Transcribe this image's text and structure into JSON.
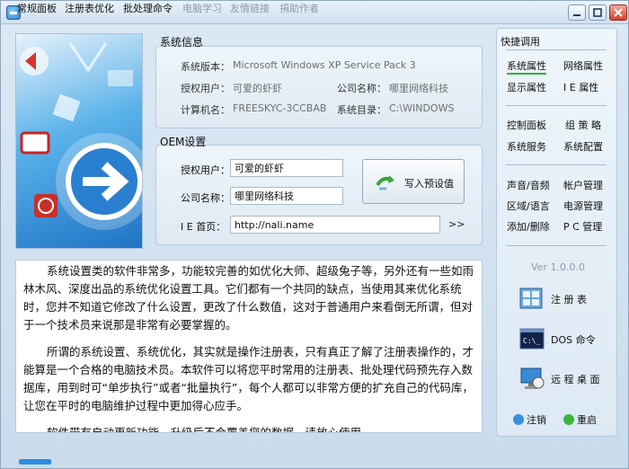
{
  "window": {
    "title": ""
  },
  "system_info": {
    "group_title": "系统信息",
    "rows": [
      {
        "label": "系统版本：",
        "value": "Microsoft Windows XP   Service Pack 3"
      },
      {
        "label": "授权用户：",
        "value": "可爱的虾虾"
      },
      {
        "label": "公司名称：",
        "value": "哪里网络科技"
      },
      {
        "label": "计算机名：",
        "value": "FREESKYC-3CCBAB"
      },
      {
        "label": "系统目录：",
        "value": "C:\\WINDOWS"
      }
    ]
  },
  "oem": {
    "group_title": "OEM设置",
    "user_label": "授权用户：",
    "user_value": "可爱的虾虾",
    "company_label": "公司名称：",
    "company_value": "哪里网络科技",
    "homepage_label": "I E 首页：",
    "homepage_value": "http://nali.name",
    "write_button": "写入预设值",
    "more": ">>"
  },
  "description": {
    "paragraphs": [
      "系统设置类的软件非常多，功能较完善的如优化大师、超级兔子等，另外还有一些如雨林木风、深度出品的系统优化设置工具。它们都有一个共同的缺点，当使用其来优化系统时，您并不知道它修改了什么设置，更改了什么数值，这对于普通用户来看倒无所谓，但对于一个技术员来说那是非常有必要掌握的。",
      "所谓的系统设置、系统优化，其实就是操作注册表，只有真正了解了注册表操作的，才能算是一个合格的电脑技术员。本软件可以将您平时常用的注册表、批处理代码预先存入数据库，用到时可“单步执行”或者“批量执行”，每个人都可以非常方便的扩充自己的代码库，让您在平时的电脑维护过程中更加得心应手。",
      "软件带有自动更新功能，升级后不会覆盖您的数据，请放心使用。"
    ]
  },
  "tabs": [
    "常规面板",
    "注册表优化",
    "批处理命令",
    "电脑学习",
    "友情链接",
    "捐助作者"
  ],
  "sidebar": {
    "title": "快捷调用",
    "links": [
      "系统属性",
      "网络属性",
      "显示属性",
      "I E 属性",
      "控制面板",
      "组 策 略",
      "系统服务",
      "系统配置",
      "声音/音频",
      "帐户管理",
      "区域/语言",
      "电源管理",
      "添加/删除",
      "P C 管理"
    ],
    "version": "Ver 1.0.0.0",
    "tools": [
      "注 册 表",
      "DOS 命令",
      "远 程 桌 面"
    ],
    "logout": "注销",
    "reboot": "重启"
  }
}
